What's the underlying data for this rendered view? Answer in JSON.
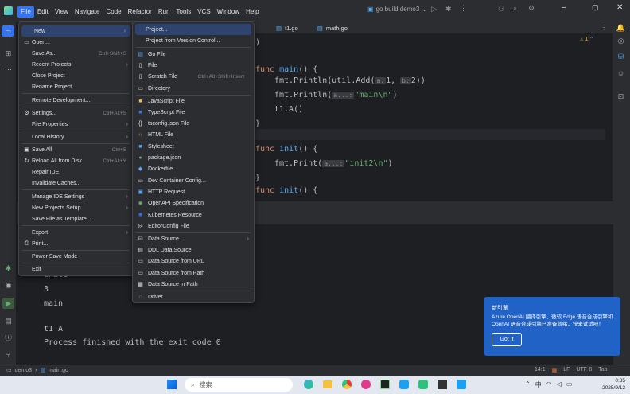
{
  "menubar": {
    "items": [
      "File",
      "Edit",
      "View",
      "Navigate",
      "Code",
      "Refactor",
      "Run",
      "Tools",
      "VCS",
      "Window",
      "Help"
    ]
  },
  "title": {
    "run_config": "go build demo3"
  },
  "tabs": [
    {
      "label": "t1.go"
    },
    {
      "label": "math.go"
    }
  ],
  "editor": {
    "warning_count": "1",
    "lines": {
      "main_sig": "func main() {",
      "println1_pre": "fmt.Println(util.Add(",
      "hint_a": "a:",
      "arg_a": "1,",
      "hint_b": "b:",
      "arg_b": "2))",
      "println2_pre": "fmt.Println(",
      "hint_a2": "a...:",
      "str_main": "\"main\\n\"",
      "close_paren": ")",
      "call_a": "t1.A()",
      "brace": "}",
      "init_sig": "func init() {",
      "print_pre": "fmt.Print(",
      "hint_a3": "a...:",
      "str_init2": "\"init2\\n\"",
      "init_sig2": "func init() {",
      "top_paren": ")"
    }
  },
  "console": {
    "lines": [
      "init1",
      "3",
      "main",
      "",
      "t1 A",
      "Process finished with the exit code 0"
    ]
  },
  "file_menu": {
    "items": [
      {
        "label": "New",
        "shortcut": "",
        "submenu": true
      },
      {
        "label": "Open...",
        "shortcut": ""
      },
      {
        "label": "Save As...",
        "shortcut": "Ctrl+Shift+S"
      },
      {
        "label": "Recent Projects",
        "shortcut": "",
        "submenu": true
      },
      {
        "label": "Close Project",
        "shortcut": ""
      },
      {
        "label": "Rename Project...",
        "shortcut": ""
      },
      {
        "label": "Remote Development...",
        "shortcut": ""
      },
      {
        "label": "Settings...",
        "shortcut": "Ctrl+Alt+S"
      },
      {
        "label": "File Properties",
        "shortcut": "",
        "submenu": true
      },
      {
        "label": "Local History",
        "shortcut": "",
        "submenu": true
      },
      {
        "label": "Save All",
        "shortcut": "Ctrl+S"
      },
      {
        "label": "Reload All from Disk",
        "shortcut": "Ctrl+Alt+Y"
      },
      {
        "label": "Repair IDE",
        "shortcut": ""
      },
      {
        "label": "Invalidate Caches...",
        "shortcut": ""
      },
      {
        "label": "Manage IDE Settings",
        "shortcut": "",
        "submenu": true
      },
      {
        "label": "New Projects Setup",
        "shortcut": "",
        "submenu": true
      },
      {
        "label": "Save File as Template...",
        "shortcut": ""
      },
      {
        "label": "Export",
        "shortcut": "",
        "submenu": true
      },
      {
        "label": "Print...",
        "shortcut": ""
      },
      {
        "label": "Power Save Mode",
        "shortcut": ""
      },
      {
        "label": "Exit",
        "shortcut": ""
      }
    ]
  },
  "new_menu": {
    "items": [
      {
        "label": "Project...",
        "shortcut": ""
      },
      {
        "label": "Project from Version Control...",
        "shortcut": ""
      },
      {
        "label": "Go File",
        "shortcut": ""
      },
      {
        "label": "File",
        "shortcut": ""
      },
      {
        "label": "Scratch File",
        "shortcut": "Ctrl+Alt+Shift+Insert"
      },
      {
        "label": "Directory",
        "shortcut": ""
      },
      {
        "label": "JavaScript File",
        "shortcut": ""
      },
      {
        "label": "TypeScript File",
        "shortcut": ""
      },
      {
        "label": "tsconfig.json File",
        "shortcut": ""
      },
      {
        "label": "HTML File",
        "shortcut": ""
      },
      {
        "label": "Stylesheet",
        "shortcut": ""
      },
      {
        "label": "package.json",
        "shortcut": ""
      },
      {
        "label": "Dockerfile",
        "shortcut": ""
      },
      {
        "label": "Dev Container Config...",
        "shortcut": ""
      },
      {
        "label": "HTTP Request",
        "shortcut": ""
      },
      {
        "label": "OpenAPI Specification",
        "shortcut": ""
      },
      {
        "label": "Kubernetes Resource",
        "shortcut": ""
      },
      {
        "label": "EditorConfig File",
        "shortcut": ""
      },
      {
        "label": "Data Source",
        "shortcut": ""
      },
      {
        "label": "DDL Data Source",
        "shortcut": ""
      },
      {
        "label": "Data Source from URL",
        "shortcut": ""
      },
      {
        "label": "Data Source from Path",
        "shortcut": ""
      },
      {
        "label": "Data Source in Path",
        "shortcut": ""
      },
      {
        "label": "Driver",
        "shortcut": ""
      }
    ]
  },
  "notification": {
    "title": "新引擎",
    "body": "Azure OpenAI 翻译引擎、微软 Edge 语音合成引擎和 OpenAI 语音合成引擎已准备就绪，快来试试吧！",
    "button": "Got It"
  },
  "statusbar": {
    "project": "demo3",
    "file": "main.go",
    "position": "14:1",
    "line_sep": "LF",
    "encoding": "UTF-8",
    "indent": "Tab"
  },
  "taskbar": {
    "search_placeholder": "搜索",
    "ime": "中",
    "time": "0:35",
    "date": "2025/9/12"
  },
  "colors": {
    "accent": "#3574f0",
    "notification": "#2162c7",
    "keyword": "#cf8e6d",
    "function": "#56a8f5",
    "string": "#6aab73"
  }
}
